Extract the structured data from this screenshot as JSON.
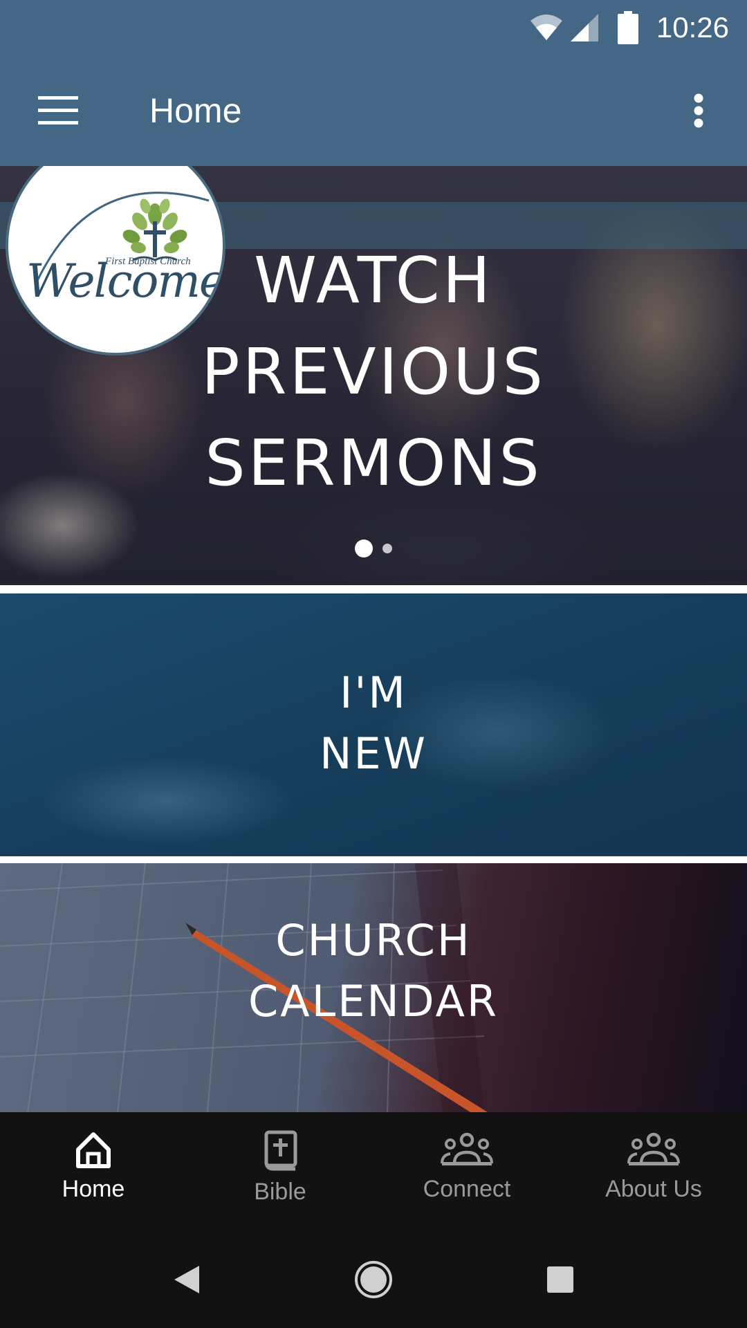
{
  "status_bar": {
    "time": "10:26",
    "icons": [
      "wifi-icon",
      "cell-signal-icon",
      "battery-icon"
    ]
  },
  "toolbar": {
    "title": "Home",
    "menu_icon": "hamburger-menu-icon",
    "overflow_icon": "more-vert-icon"
  },
  "carousel": {
    "logo": {
      "word": "Welcome",
      "tagline": "First Baptist Church"
    },
    "banner_lines": [
      "WATCH",
      "PREVIOUS",
      "SERMONS"
    ],
    "page_count": 2,
    "active_page": 1
  },
  "tiles": [
    {
      "lines": [
        "I'M",
        "NEW"
      ]
    },
    {
      "lines": [
        "CHURCH",
        "CALENDAR"
      ]
    }
  ],
  "bottom_nav": {
    "items": [
      {
        "label": "Home",
        "icon": "home-icon",
        "active": true
      },
      {
        "label": "Bible",
        "icon": "bible-icon",
        "active": false
      },
      {
        "label": "Connect",
        "icon": "group-icon",
        "active": false
      },
      {
        "label": "About Us",
        "icon": "group-icon",
        "active": false
      }
    ]
  },
  "system_nav": {
    "buttons": [
      "back-icon",
      "home-circle-icon",
      "recents-icon"
    ]
  },
  "colors": {
    "app_bar": "#436784",
    "nav_background": "#121212",
    "nav_active": "#ffffff",
    "nav_inactive": "#9a9a9a"
  }
}
